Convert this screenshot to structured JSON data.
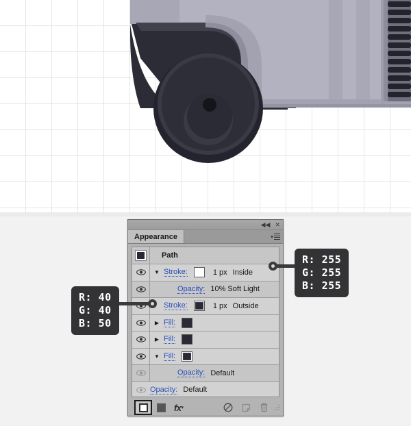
{
  "artwork": {
    "name": "vehicle-corner-wheel-illustration",
    "background_grid_color": "#e6e6e8",
    "palette": {
      "body_light": "#b3b3c0",
      "body_mid": "#9a9aa8",
      "body_shadow": "#7f7f8e",
      "dark_panel": "#2b2b35",
      "dark_panel_2": "#3c3c48",
      "tire_outer": "#24242e",
      "rim": "#3c3c46",
      "hub": "#2e2e38",
      "hub_center": "#14141a",
      "vent_slat": "#23232d",
      "vent_bg": "#6e6e7c"
    }
  },
  "panel": {
    "titlebar": {
      "collapse_icon": "collapse-to-icons",
      "close_icon": "close",
      "collapse_glyph": "◀◀",
      "close_glyph": "✕"
    },
    "tab_label": "Appearance",
    "menu_icon": "panel-menu",
    "header_row": {
      "title": "Path",
      "thumbnail_color": "#2a2a36"
    },
    "rows": [
      {
        "id": "stroke-inside",
        "kind": "stroke",
        "eye": "visible",
        "caret": "▼",
        "label": "Stroke:",
        "swatch_color": "#ffffff",
        "swatch_selected": false,
        "meta": "1 px",
        "meta2": "Inside",
        "indented": false,
        "shaded": false
      },
      {
        "id": "stroke-inside-opacity",
        "kind": "opacity",
        "eye": "visible",
        "caret": "",
        "label": "Opacity:",
        "swatch_color": null,
        "swatch_selected": false,
        "meta": "10% Soft Light",
        "meta2": "",
        "indented": true,
        "shaded": true
      },
      {
        "id": "stroke-outside",
        "kind": "stroke",
        "eye": "visible",
        "caret": "",
        "label": "Stroke:",
        "swatch_color": "#2a2a36",
        "swatch_selected": true,
        "meta": "1 px",
        "meta2": "Outside",
        "indented": false,
        "shaded": false
      },
      {
        "id": "fill-1",
        "kind": "fill",
        "eye": "visible",
        "caret": "▶",
        "label": "Fill:",
        "swatch_color": "#2a2a36",
        "swatch_selected": false,
        "meta": "",
        "meta2": "",
        "indented": false,
        "shaded": false
      },
      {
        "id": "fill-2",
        "kind": "fill",
        "eye": "visible",
        "caret": "▶",
        "label": "Fill:",
        "swatch_color": "#2a2a36",
        "swatch_selected": false,
        "meta": "",
        "meta2": "",
        "indented": false,
        "shaded": false
      },
      {
        "id": "fill-3",
        "kind": "fill",
        "eye": "visible",
        "caret": "▼",
        "label": "Fill:",
        "swatch_color": "#2a2a36",
        "swatch_selected": true,
        "meta": "",
        "meta2": "",
        "indented": false,
        "shaded": false
      },
      {
        "id": "fill-3-opacity",
        "kind": "opacity",
        "eye": "dim",
        "caret": "",
        "label": "Opacity:",
        "swatch_color": null,
        "swatch_selected": false,
        "meta": "Default",
        "meta2": "",
        "indented": true,
        "shaded": true
      },
      {
        "id": "object-opacity",
        "kind": "opacity-root",
        "eye": "dim",
        "caret": "",
        "label": "Opacity:",
        "swatch_color": null,
        "swatch_selected": false,
        "meta": "Default",
        "meta2": "",
        "indented": false,
        "shaded": false
      }
    ],
    "footer": {
      "add_stroke": "add-new-stroke",
      "add_fill": "add-new-fill",
      "fx_label": "fx",
      "clear_appearance": "clear-appearance",
      "duplicate_item": "duplicate-selected-item",
      "delete_item": "delete-selected-item",
      "resize_grip": "resize-grip"
    }
  },
  "callouts": {
    "left": {
      "text": "R: 40\nG: 40\nB: 50",
      "r": "40",
      "g": "40",
      "b": "50",
      "points_at": "stroke-outside",
      "bg": "#333336"
    },
    "right": {
      "text": "R: 255\nG: 255\nB: 255",
      "r": "255",
      "g": "255",
      "b": "255",
      "points_at": "stroke-inside",
      "bg": "#333336"
    }
  }
}
